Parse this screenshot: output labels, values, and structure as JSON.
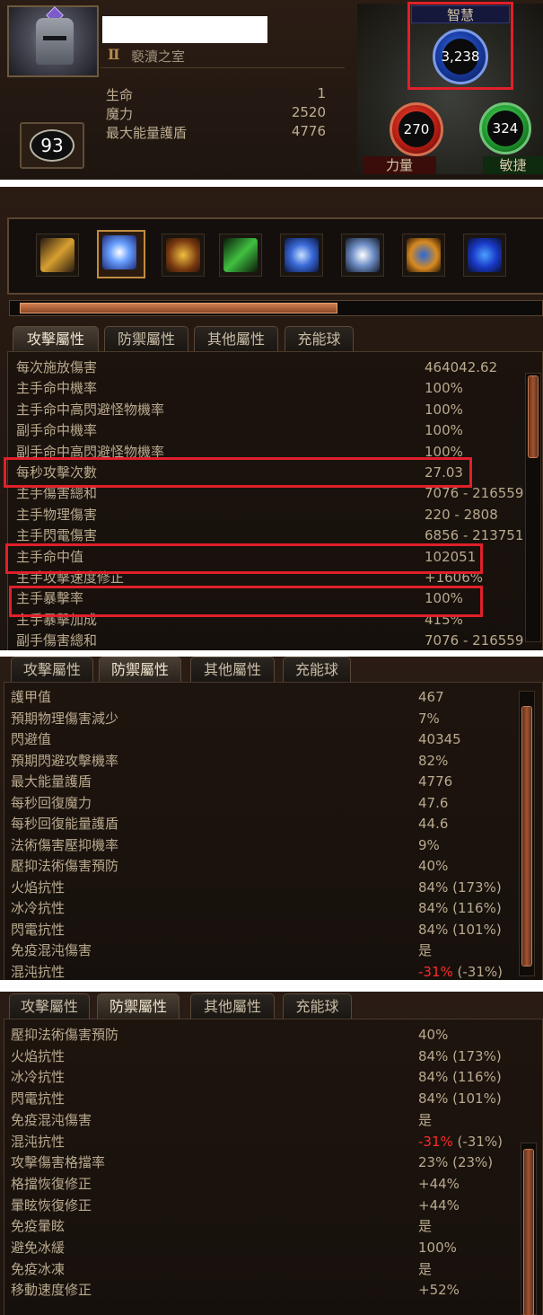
{
  "header": {
    "league_name": "褻瀆之室",
    "class_icon": "roman-numeral-two-icon",
    "level": "93",
    "stats": [
      {
        "label": "生命",
        "value": "1"
      },
      {
        "label": "魔力",
        "value": "2520"
      },
      {
        "label": "最大能量護盾",
        "value": "4776"
      }
    ],
    "attributes": {
      "intelligence": {
        "label": "智慧",
        "value": "3,238",
        "color": "#2a55c8"
      },
      "strength": {
        "label": "力量",
        "value": "270",
        "color": "#c0241a"
      },
      "dexterity": {
        "label": "敏捷",
        "value": "324",
        "color": "#24a033"
      }
    },
    "highlight_color": "#e0202a"
  },
  "skills": [
    {
      "icon": "dagger-icon"
    },
    {
      "icon": "spell-burst-icon",
      "selected": true
    },
    {
      "icon": "lightning-ring-icon"
    },
    {
      "icon": "green-blade-icon"
    },
    {
      "icon": "lightning-bolt-icon"
    },
    {
      "icon": "frost-nova-icon"
    },
    {
      "icon": "orb-ring-icon"
    },
    {
      "icon": "hand-rune-icon"
    }
  ],
  "experience_progress": 0.6,
  "tabs": [
    "攻擊屬性",
    "防禦屬性",
    "其他屬性",
    "充能球"
  ],
  "offense": {
    "rows": [
      {
        "label": "每次施放傷害",
        "value": "464042.62"
      },
      {
        "label": "主手命中機率",
        "value": "100%"
      },
      {
        "label": "主手命中高閃避怪物機率",
        "value": "100%"
      },
      {
        "label": "副手命中機率",
        "value": "100%"
      },
      {
        "label": "副手命中高閃避怪物機率",
        "value": "100%"
      },
      {
        "label": "每秒攻擊次數",
        "value": "27.03",
        "highlight": true
      },
      {
        "label": "主手傷害總和",
        "value": "7076 - 216559"
      },
      {
        "label": "主手物理傷害",
        "value": "220 - 2808"
      },
      {
        "label": "主手閃電傷害",
        "value": "6856 - 213751"
      },
      {
        "label": "主手命中值",
        "value": "102051",
        "highlight": true
      },
      {
        "label": "主手攻擊速度修正",
        "value": "+1606%"
      },
      {
        "label": "主手暴擊率",
        "value": "100%",
        "highlight": true
      },
      {
        "label": "主手暴擊加成",
        "value": "415%"
      },
      {
        "label": "副手傷害總和",
        "value": "7076 - 216559"
      }
    ]
  },
  "defense_view_1": {
    "rows": [
      {
        "label": "護甲值",
        "value": "467"
      },
      {
        "label": "預期物理傷害減少",
        "value": "7%"
      },
      {
        "label": "閃避值",
        "value": "40345"
      },
      {
        "label": "預期閃避攻擊機率",
        "value": "82%"
      },
      {
        "label": "最大能量護盾",
        "value": "4776"
      },
      {
        "label": "每秒回復魔力",
        "value": "47.6"
      },
      {
        "label": "每秒回復能量護盾",
        "value": "44.6"
      },
      {
        "label": "法術傷害壓抑機率",
        "value": "9%"
      },
      {
        "label": "壓抑法術傷害預防",
        "value": "40%"
      },
      {
        "label": "火焰抗性",
        "value": "84% (173%)"
      },
      {
        "label": "冰冷抗性",
        "value": "84% (116%)"
      },
      {
        "label": "閃電抗性",
        "value": "84% (101%)"
      },
      {
        "label": "免疫混沌傷害",
        "value": "是"
      },
      {
        "label": "混沌抗性",
        "value_neg": "-31%",
        "value_rest": " (-31%)"
      }
    ]
  },
  "defense_view_2": {
    "rows": [
      {
        "label": "壓抑法術傷害預防",
        "value": "40%"
      },
      {
        "label": "火焰抗性",
        "value": "84% (173%)"
      },
      {
        "label": "冰冷抗性",
        "value": "84% (116%)"
      },
      {
        "label": "閃電抗性",
        "value": "84% (101%)"
      },
      {
        "label": "免疫混沌傷害",
        "value": "是"
      },
      {
        "label": "混沌抗性",
        "value_neg": "-31%",
        "value_rest": " (-31%)"
      },
      {
        "label": "攻擊傷害格擋率",
        "value": "23% (23%)"
      },
      {
        "label": "格擋恢復修正",
        "value": "+44%"
      },
      {
        "label": "暈眩恢復修正",
        "value": "+44%"
      },
      {
        "label": "免疫暈眩",
        "value": "是"
      },
      {
        "label": "避免冰緩",
        "value": "100%"
      },
      {
        "label": "免疫冰凍",
        "value": "是"
      },
      {
        "label": "移動速度修正",
        "value": "+52%"
      }
    ]
  }
}
